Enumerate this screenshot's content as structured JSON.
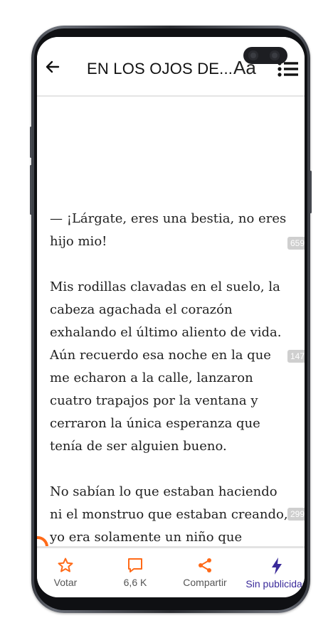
{
  "header": {
    "title": "EN LOS OJOS DE...",
    "font_button": "Aa"
  },
  "content": {
    "paragraphs": [
      "— ¡Lárgate, eres una bestia, no eres hijo mio!",
      "Mis rodillas clavadas en el suelo, la cabeza agachada el corazón exhalando el último aliento de vida. Aún recuerdo esa noche en la que me echaron a la calle, lanzaron cuatro trapajos  por la ventana y cerraron la única esperanza que tenía de ser alguien bueno.",
      "No sabían lo que estaban haciendo ni el monstruo que estaban creando, yo era solamente un niño que anhelaba"
    ],
    "comment_counts": [
      "659",
      "147",
      "299"
    ]
  },
  "bottom_nav": {
    "vote": "Votar",
    "comments": "6,6 K",
    "share": "Compartir",
    "no_ads": "Sin publicidad"
  },
  "colors": {
    "accent_orange": "#ff6a18",
    "accent_purple": "#3a2a9a",
    "text": "#1f1f1f"
  },
  "icons": {
    "back": "arrow-left-icon",
    "toc": "list-icon",
    "vote": "star-icon",
    "comments": "comment-icon",
    "share": "share-icon",
    "no_ads": "lightning-icon"
  }
}
